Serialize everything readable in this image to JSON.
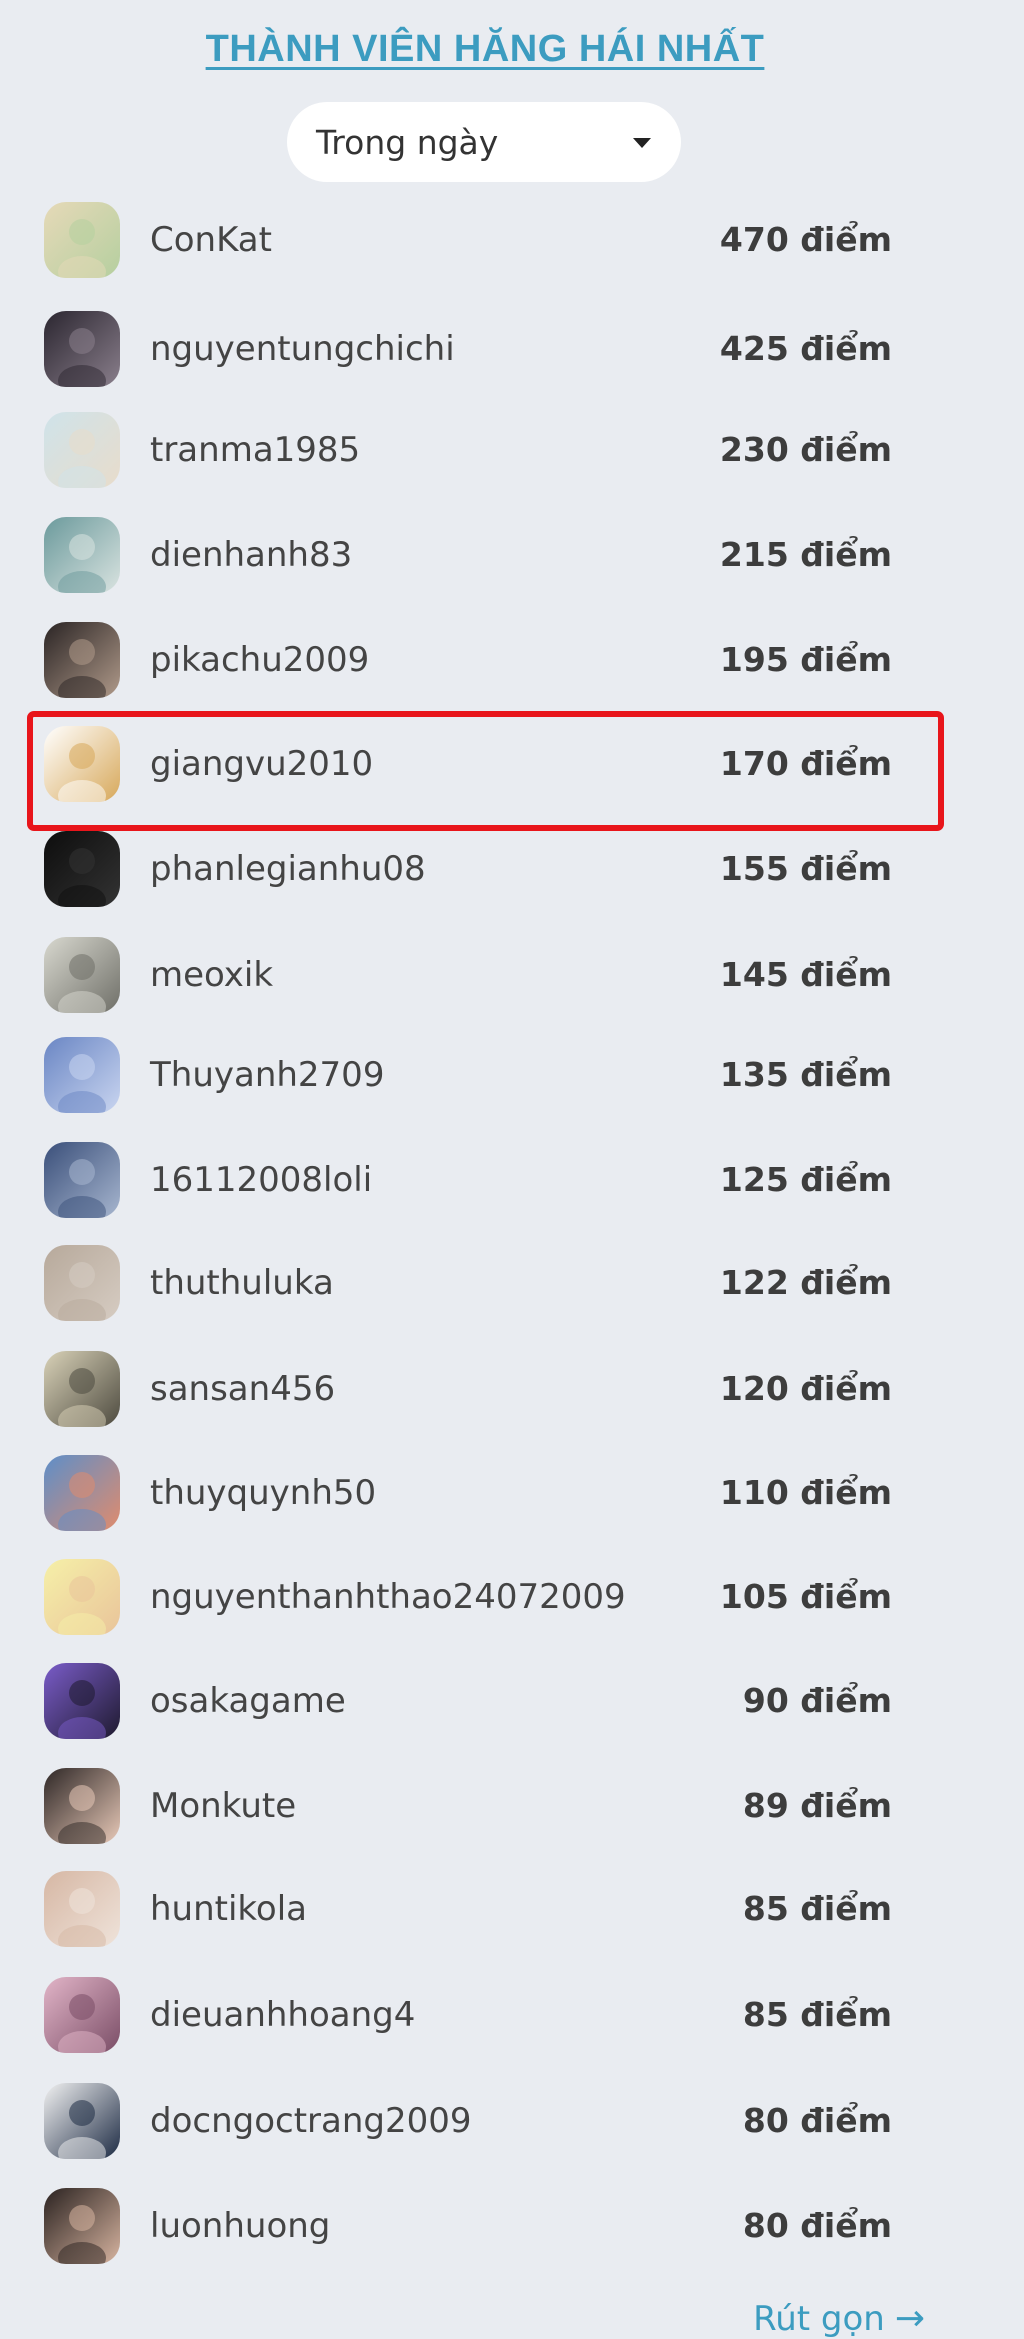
{
  "widget": {
    "title": "THÀNH VIÊN HĂNG HÁI NHẤT",
    "filter": {
      "selected": "Trong ngày",
      "icon": "caret-down-icon"
    },
    "collapse_label": "Rút gọn",
    "collapse_icon": "→"
  },
  "members": [
    {
      "username": "ConKat",
      "score": "470 điểm",
      "colors": [
        "#e6d9b8",
        "#b5cf9f"
      ]
    },
    {
      "username": "nguyentungchichi",
      "score": "425 điểm",
      "colors": [
        "#2b2630",
        "#8a7f8c"
      ]
    },
    {
      "username": "tranma1985",
      "score": "230 điểm",
      "colors": [
        "#cfe3ea",
        "#e8dccb"
      ]
    },
    {
      "username": "dienhanh83",
      "score": "215 điểm",
      "colors": [
        "#6b9a9c",
        "#d9e3e0"
      ]
    },
    {
      "username": "pikachu2009",
      "score": "195 điểm",
      "colors": [
        "#2a2424",
        "#b09a8a"
      ]
    },
    {
      "username": "giangvu2010",
      "score": "170 điểm",
      "colors": [
        "#ffffff",
        "#d7a85a"
      ],
      "highlighted": true
    },
    {
      "username": "phanlegianhu08",
      "score": "155 điểm",
      "colors": [
        "#0d0d0d",
        "#333333"
      ]
    },
    {
      "username": "meoxik",
      "score": "145 điểm",
      "colors": [
        "#d8d8cf",
        "#6f6f68"
      ]
    },
    {
      "username": "Thuyanh2709",
      "score": "135 điểm",
      "colors": [
        "#6a86c4",
        "#c9d5f0"
      ]
    },
    {
      "username": "16112008loli",
      "score": "125 điểm",
      "colors": [
        "#3a4f7a",
        "#a7b6cf"
      ]
    },
    {
      "username": "thuthuluka",
      "score": "122 điểm",
      "colors": [
        "#b7a99b",
        "#d6ccc2"
      ]
    },
    {
      "username": "sansan456",
      "score": "120 điểm",
      "colors": [
        "#d9d2b8",
        "#4d4a3f"
      ]
    },
    {
      "username": "thuyquynh50",
      "score": "110 điểm",
      "colors": [
        "#5d8ec9",
        "#e08c6d"
      ]
    },
    {
      "username": "nguyenthanhthao24072009",
      "score": "105 điểm",
      "colors": [
        "#f6f0a8",
        "#e9c49a"
      ]
    },
    {
      "username": "osakagame",
      "score": "90 điểm",
      "colors": [
        "#7a5cc9",
        "#1e1a2e"
      ]
    },
    {
      "username": "Monkute",
      "score": "89 điểm",
      "colors": [
        "#2e2726",
        "#e8c9b8"
      ]
    },
    {
      "username": "huntikola",
      "score": "85 điểm",
      "colors": [
        "#d6b7a4",
        "#efe3da"
      ]
    },
    {
      "username": "dieuanhhoang4",
      "score": "85 điểm",
      "colors": [
        "#e2b5c8",
        "#7a4d66"
      ]
    },
    {
      "username": "docngoctrang2009",
      "score": "80 điểm",
      "colors": [
        "#f2f2f2",
        "#1d2b44"
      ]
    },
    {
      "username": "luonhuong",
      "score": "80 điểm",
      "colors": [
        "#2a2220",
        "#d7b4a0"
      ]
    }
  ]
}
